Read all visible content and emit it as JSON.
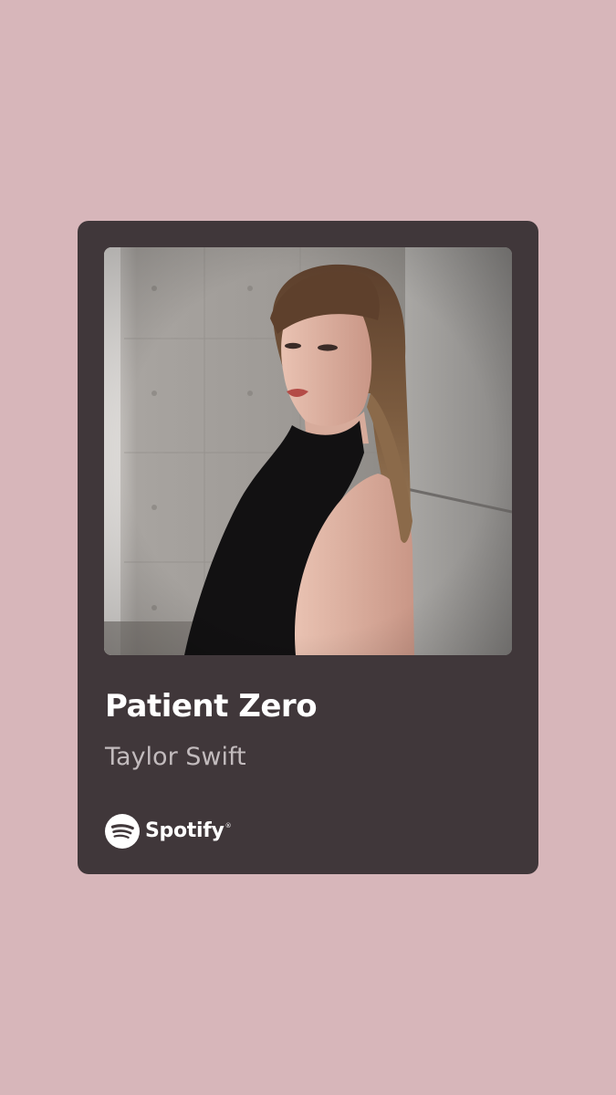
{
  "background_color": "#d7b6ba",
  "card": {
    "background_color": "#40373a",
    "cover_icon": "album-cover-photo",
    "title": "Patient Zero",
    "artist": "Taylor Swift",
    "brand": {
      "icon": "spotify-logo-icon",
      "name": "Spotify",
      "trademark": "®"
    }
  }
}
